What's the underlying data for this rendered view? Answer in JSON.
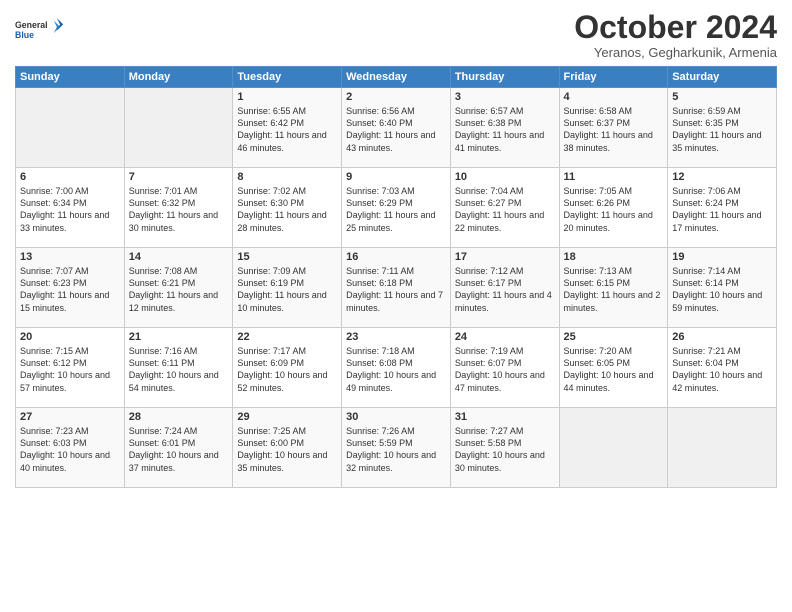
{
  "header": {
    "logo_line1": "General",
    "logo_line2": "Blue",
    "month": "October 2024",
    "location": "Yeranos, Gegharkunik, Armenia"
  },
  "weekdays": [
    "Sunday",
    "Monday",
    "Tuesday",
    "Wednesday",
    "Thursday",
    "Friday",
    "Saturday"
  ],
  "weeks": [
    [
      {
        "day": "",
        "sunrise": "",
        "sunset": "",
        "daylight": "",
        "empty": true
      },
      {
        "day": "",
        "sunrise": "",
        "sunset": "",
        "daylight": "",
        "empty": true
      },
      {
        "day": "1",
        "sunrise": "Sunrise: 6:55 AM",
        "sunset": "Sunset: 6:42 PM",
        "daylight": "Daylight: 11 hours and 46 minutes."
      },
      {
        "day": "2",
        "sunrise": "Sunrise: 6:56 AM",
        "sunset": "Sunset: 6:40 PM",
        "daylight": "Daylight: 11 hours and 43 minutes."
      },
      {
        "day": "3",
        "sunrise": "Sunrise: 6:57 AM",
        "sunset": "Sunset: 6:38 PM",
        "daylight": "Daylight: 11 hours and 41 minutes."
      },
      {
        "day": "4",
        "sunrise": "Sunrise: 6:58 AM",
        "sunset": "Sunset: 6:37 PM",
        "daylight": "Daylight: 11 hours and 38 minutes."
      },
      {
        "day": "5",
        "sunrise": "Sunrise: 6:59 AM",
        "sunset": "Sunset: 6:35 PM",
        "daylight": "Daylight: 11 hours and 35 minutes."
      }
    ],
    [
      {
        "day": "6",
        "sunrise": "Sunrise: 7:00 AM",
        "sunset": "Sunset: 6:34 PM",
        "daylight": "Daylight: 11 hours and 33 minutes."
      },
      {
        "day": "7",
        "sunrise": "Sunrise: 7:01 AM",
        "sunset": "Sunset: 6:32 PM",
        "daylight": "Daylight: 11 hours and 30 minutes."
      },
      {
        "day": "8",
        "sunrise": "Sunrise: 7:02 AM",
        "sunset": "Sunset: 6:30 PM",
        "daylight": "Daylight: 11 hours and 28 minutes."
      },
      {
        "day": "9",
        "sunrise": "Sunrise: 7:03 AM",
        "sunset": "Sunset: 6:29 PM",
        "daylight": "Daylight: 11 hours and 25 minutes."
      },
      {
        "day": "10",
        "sunrise": "Sunrise: 7:04 AM",
        "sunset": "Sunset: 6:27 PM",
        "daylight": "Daylight: 11 hours and 22 minutes."
      },
      {
        "day": "11",
        "sunrise": "Sunrise: 7:05 AM",
        "sunset": "Sunset: 6:26 PM",
        "daylight": "Daylight: 11 hours and 20 minutes."
      },
      {
        "day": "12",
        "sunrise": "Sunrise: 7:06 AM",
        "sunset": "Sunset: 6:24 PM",
        "daylight": "Daylight: 11 hours and 17 minutes."
      }
    ],
    [
      {
        "day": "13",
        "sunrise": "Sunrise: 7:07 AM",
        "sunset": "Sunset: 6:23 PM",
        "daylight": "Daylight: 11 hours and 15 minutes."
      },
      {
        "day": "14",
        "sunrise": "Sunrise: 7:08 AM",
        "sunset": "Sunset: 6:21 PM",
        "daylight": "Daylight: 11 hours and 12 minutes."
      },
      {
        "day": "15",
        "sunrise": "Sunrise: 7:09 AM",
        "sunset": "Sunset: 6:19 PM",
        "daylight": "Daylight: 11 hours and 10 minutes."
      },
      {
        "day": "16",
        "sunrise": "Sunrise: 7:11 AM",
        "sunset": "Sunset: 6:18 PM",
        "daylight": "Daylight: 11 hours and 7 minutes."
      },
      {
        "day": "17",
        "sunrise": "Sunrise: 7:12 AM",
        "sunset": "Sunset: 6:17 PM",
        "daylight": "Daylight: 11 hours and 4 minutes."
      },
      {
        "day": "18",
        "sunrise": "Sunrise: 7:13 AM",
        "sunset": "Sunset: 6:15 PM",
        "daylight": "Daylight: 11 hours and 2 minutes."
      },
      {
        "day": "19",
        "sunrise": "Sunrise: 7:14 AM",
        "sunset": "Sunset: 6:14 PM",
        "daylight": "Daylight: 10 hours and 59 minutes."
      }
    ],
    [
      {
        "day": "20",
        "sunrise": "Sunrise: 7:15 AM",
        "sunset": "Sunset: 6:12 PM",
        "daylight": "Daylight: 10 hours and 57 minutes."
      },
      {
        "day": "21",
        "sunrise": "Sunrise: 7:16 AM",
        "sunset": "Sunset: 6:11 PM",
        "daylight": "Daylight: 10 hours and 54 minutes."
      },
      {
        "day": "22",
        "sunrise": "Sunrise: 7:17 AM",
        "sunset": "Sunset: 6:09 PM",
        "daylight": "Daylight: 10 hours and 52 minutes."
      },
      {
        "day": "23",
        "sunrise": "Sunrise: 7:18 AM",
        "sunset": "Sunset: 6:08 PM",
        "daylight": "Daylight: 10 hours and 49 minutes."
      },
      {
        "day": "24",
        "sunrise": "Sunrise: 7:19 AM",
        "sunset": "Sunset: 6:07 PM",
        "daylight": "Daylight: 10 hours and 47 minutes."
      },
      {
        "day": "25",
        "sunrise": "Sunrise: 7:20 AM",
        "sunset": "Sunset: 6:05 PM",
        "daylight": "Daylight: 10 hours and 44 minutes."
      },
      {
        "day": "26",
        "sunrise": "Sunrise: 7:21 AM",
        "sunset": "Sunset: 6:04 PM",
        "daylight": "Daylight: 10 hours and 42 minutes."
      }
    ],
    [
      {
        "day": "27",
        "sunrise": "Sunrise: 7:23 AM",
        "sunset": "Sunset: 6:03 PM",
        "daylight": "Daylight: 10 hours and 40 minutes."
      },
      {
        "day": "28",
        "sunrise": "Sunrise: 7:24 AM",
        "sunset": "Sunset: 6:01 PM",
        "daylight": "Daylight: 10 hours and 37 minutes."
      },
      {
        "day": "29",
        "sunrise": "Sunrise: 7:25 AM",
        "sunset": "Sunset: 6:00 PM",
        "daylight": "Daylight: 10 hours and 35 minutes."
      },
      {
        "day": "30",
        "sunrise": "Sunrise: 7:26 AM",
        "sunset": "Sunset: 5:59 PM",
        "daylight": "Daylight: 10 hours and 32 minutes."
      },
      {
        "day": "31",
        "sunrise": "Sunrise: 7:27 AM",
        "sunset": "Sunset: 5:58 PM",
        "daylight": "Daylight: 10 hours and 30 minutes."
      },
      {
        "day": "",
        "sunrise": "",
        "sunset": "",
        "daylight": "",
        "empty": true
      },
      {
        "day": "",
        "sunrise": "",
        "sunset": "",
        "daylight": "",
        "empty": true
      }
    ]
  ]
}
